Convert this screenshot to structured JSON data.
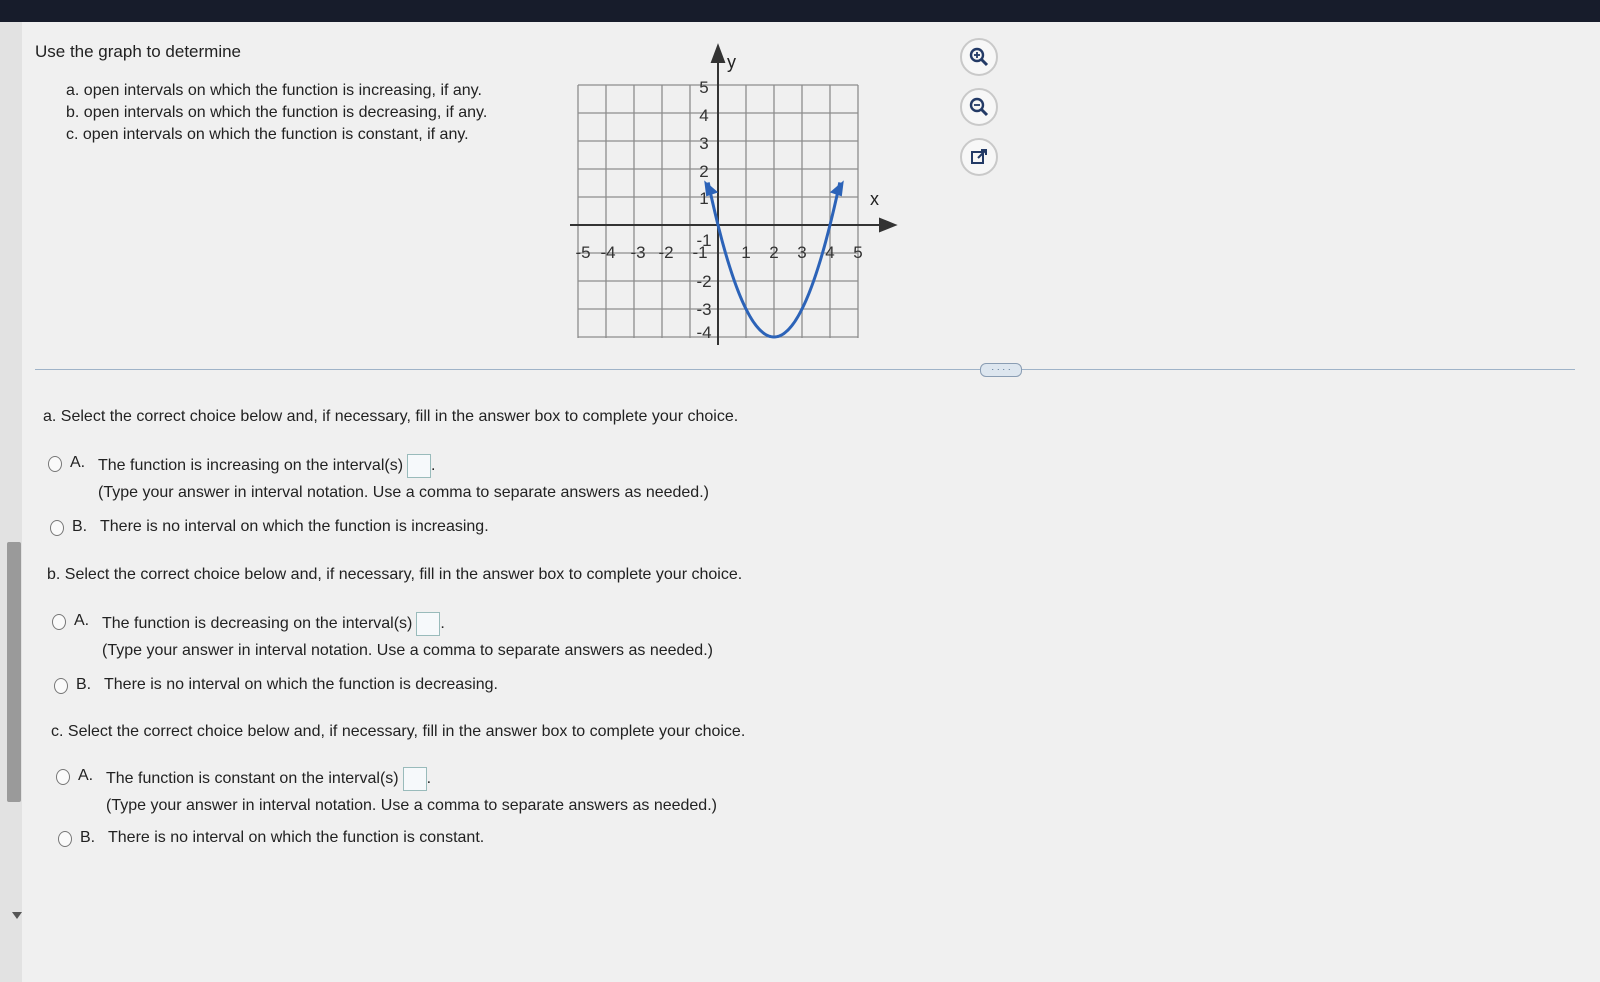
{
  "problem": {
    "intro": "Use the graph to determine",
    "items": [
      "a. open intervals on which the function is increasing, if any.",
      "b. open intervals on which the function is decreasing, if any.",
      "c. open intervals on which the function is constant, if any."
    ]
  },
  "graph": {
    "x_axis_label": "x",
    "y_axis_label": "y",
    "x_ticks": [
      "-5",
      "-4",
      "-3",
      "-2",
      "-1",
      "1",
      "2",
      "3",
      "4",
      "5"
    ],
    "y_ticks": [
      "5",
      "4",
      "3",
      "2",
      "1",
      "-1",
      "-2",
      "-3",
      "-4"
    ],
    "curve_color": "#2c63b8"
  },
  "toolbar": {
    "icons": [
      "zoom-in-icon",
      "zoom-out-icon",
      "popout-icon"
    ]
  },
  "more_label": "· · · ·",
  "parts": {
    "a": {
      "question": "a. Select the correct choice below and, if necessary, fill in the answer box to complete your choice.",
      "optA_letter": "A.",
      "optA_text": "The function is increasing on the interval(s)",
      "optA_hint": "(Type your answer in interval notation. Use a comma to separate answers as needed.)",
      "optB_letter": "B.",
      "optB_text": "There is no interval on which the function is increasing."
    },
    "b": {
      "question": "b. Select the correct choice below and, if necessary, fill in the answer box to complete your choice.",
      "optA_letter": "A.",
      "optA_text": "The function is decreasing on the interval(s)",
      "optA_hint": "(Type your answer in interval notation. Use a comma to separate answers as needed.)",
      "optB_letter": "B.",
      "optB_text": "There is no interval on which the function is decreasing."
    },
    "c": {
      "question": "c. Select the correct choice below and, if necessary, fill in the answer box to complete your choice.",
      "optA_letter": "A.",
      "optA_text": "The function is constant on the interval(s)",
      "optA_hint": "(Type your answer in interval notation. Use a comma to separate answers as needed.)",
      "optB_letter": "B.",
      "optB_text": "There is no interval on which the function is constant."
    }
  }
}
